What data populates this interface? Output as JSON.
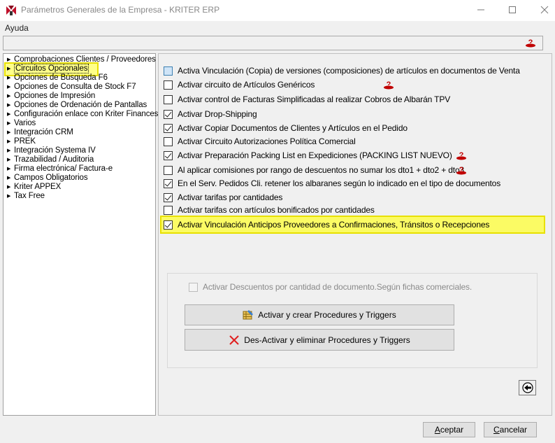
{
  "window": {
    "title": "Parámetros Generales de la Empresa - KRITER ERP"
  },
  "menu": {
    "help": "Ayuda"
  },
  "tree": {
    "items": [
      {
        "label": "Comprobaciones Clientes / Proveedores"
      },
      {
        "label": "Circuitos Opcionales",
        "selected": true
      },
      {
        "label": "Opciones de Búsqueda F6"
      },
      {
        "label": "Opciones de Consulta de Stock F7"
      },
      {
        "label": "Opciones de Impresión"
      },
      {
        "label": "Opciones de Ordenación de Pantallas"
      },
      {
        "label": "Configuración enlace con Kriter Finances"
      },
      {
        "label": "Varios"
      },
      {
        "label": "Integración CRM"
      },
      {
        "label": "PREK"
      },
      {
        "label": "Integración Systema IV"
      },
      {
        "label": "Trazabilidad / Auditoria"
      },
      {
        "label": "Firma electrónica/ Factura-e"
      },
      {
        "label": "Campos Obligatorios"
      },
      {
        "label": "Kriter APPEX"
      },
      {
        "label": "Tax Free"
      }
    ]
  },
  "options": [
    {
      "label": "Activa Vinculación (Copia) de versiones (composiciones) de artículos en documentos de Venta",
      "checked": false,
      "focused": true
    },
    {
      "label": "Activar circuito de Artículos Genéricos",
      "checked": false,
      "help": true
    },
    {
      "label": "Activar control de Facturas Simplificadas al realizar Cobros de Albarán TPV",
      "checked": false
    },
    {
      "label": "Activar Drop-Shipping",
      "checked": true
    },
    {
      "label": "Activar Copiar Documentos de Clientes y Artículos en el Pedido",
      "checked": true
    },
    {
      "label": "Activar Circuito Autorizaciones Política Comercial",
      "checked": false
    },
    {
      "label": "Activar Preparación Packing List en Expediciones (PACKING LIST NUEVO)",
      "checked": true,
      "help": true
    },
    {
      "label": "Al aplicar comisiones por rango de descuentos no sumar los dto1 + dto2 + dto3",
      "checked": false,
      "help": true
    },
    {
      "label": "En el Serv. Pedidos Cli. retener los albaranes según lo indicado en el tipo de documentos",
      "checked": true
    },
    {
      "label": "Activar tarifas por cantidades",
      "checked": true
    },
    {
      "label": "Activar tarifas con artículos bonificados por cantidades",
      "checked": false
    },
    {
      "label": "Activar Vinculación Anticipos Proveedores a Confirmaciones, Tránsitos o Recepciones",
      "checked": true,
      "highlighted": true
    }
  ],
  "group": {
    "discount_label": "Activar Descuentos por cantidad de documento.Según fichas comerciales.",
    "activate_button": "Activar y crear Procedures y Triggers",
    "deactivate_button": "Des-Activar y eliminar Procedures y Triggers"
  },
  "footer": {
    "accept_rest": "ceptar",
    "accept_accel": "A",
    "cancel_rest": "ancelar",
    "cancel_accel": "C"
  },
  "colors": {
    "highlight": "#ffff28",
    "selection_border": "#e8e000",
    "help_icon": "#c00000"
  }
}
